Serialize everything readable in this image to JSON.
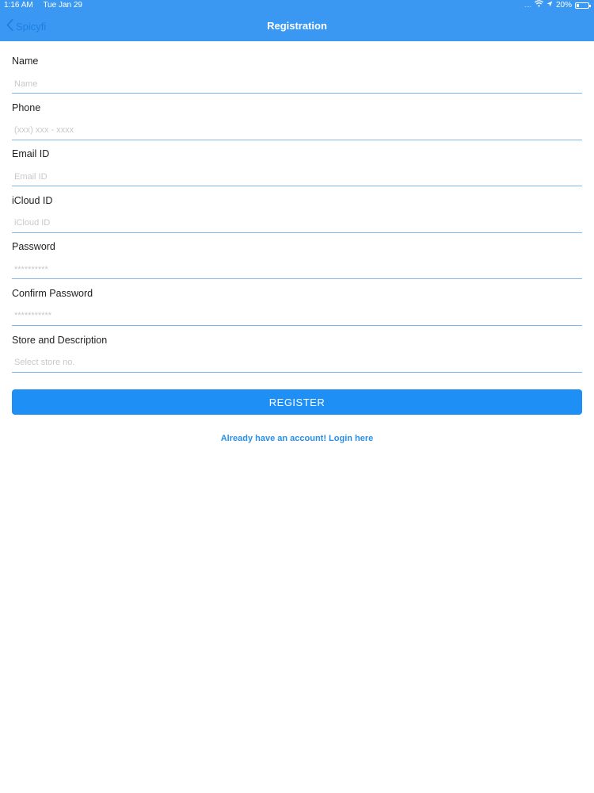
{
  "status_bar": {
    "time": "1:16 AM",
    "date": "Tue Jan 29",
    "signal": "....",
    "battery": "20%",
    "battery_level": 0.2
  },
  "nav": {
    "back_label": "Spicyfi",
    "title": "Registration"
  },
  "form": {
    "fields": [
      {
        "label": "Name",
        "placeholder": "Name"
      },
      {
        "label": "Phone",
        "placeholder": "(xxx) xxx - xxxx"
      },
      {
        "label": "Email ID",
        "placeholder": "Email ID"
      },
      {
        "label": "iCloud ID",
        "placeholder": "iCloud ID"
      },
      {
        "label": "Password",
        "placeholder": "**********"
      },
      {
        "label": "Confirm Password",
        "placeholder": "***********"
      },
      {
        "label": "Store and Description",
        "placeholder": "Select store no."
      }
    ]
  },
  "actions": {
    "register_label": "REGISTER",
    "login_link": "Already have an account! Login here"
  },
  "colors": {
    "accent": "#1e8ff5",
    "navbar": "#3a98f3"
  }
}
